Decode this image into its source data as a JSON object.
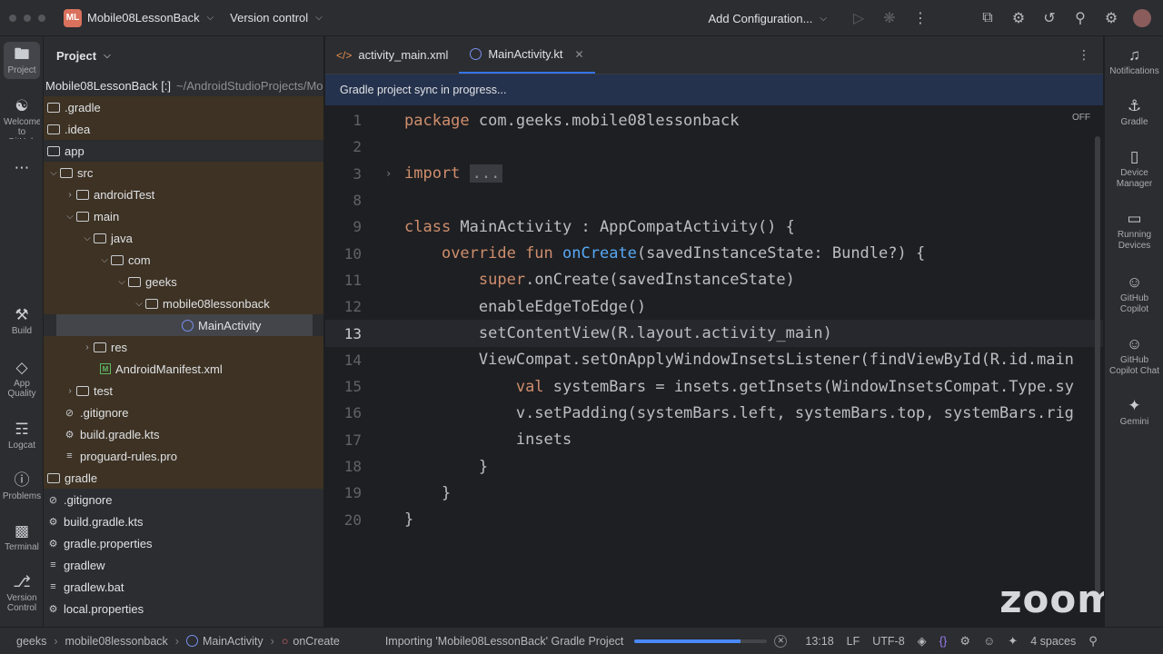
{
  "titlebar": {
    "project_badge": "ML",
    "project_name": "Mobile08LessonBack",
    "vcs_label": "Version control",
    "add_config": "Add Configuration..."
  },
  "left_strip": [
    {
      "label": "Project",
      "icon": "folder-icon"
    },
    {
      "label": "Welcome to GitHub",
      "icon": "github-icon"
    },
    {
      "label": "Build",
      "icon": "hammer-icon"
    },
    {
      "label": "App Quality",
      "icon": "diamond-icon"
    },
    {
      "label": "Logcat",
      "icon": "logcat-icon"
    },
    {
      "label": "Problems",
      "icon": "warning-icon"
    },
    {
      "label": "Terminal",
      "icon": "terminal-icon"
    },
    {
      "label": "Version Control",
      "icon": "git-branch-icon"
    }
  ],
  "project_panel": {
    "title": "Project",
    "root_name": "Mobile08LessonBack [:]",
    "root_path": "~/AndroidStudioProjects/Mobile08LessonBack",
    "tree": [
      {
        "label": ".gradle"
      },
      {
        "label": ".idea"
      },
      {
        "label": "app"
      },
      {
        "label": "src"
      },
      {
        "label": "androidTest"
      },
      {
        "label": "main"
      },
      {
        "label": "java"
      },
      {
        "label": "com"
      },
      {
        "label": "geeks"
      },
      {
        "label": "mobile08lessonback"
      },
      {
        "label": "MainActivity"
      },
      {
        "label": "res"
      },
      {
        "label": "AndroidManifest.xml"
      },
      {
        "label": "test"
      },
      {
        "label": ".gitignore"
      },
      {
        "label": "build.gradle.kts"
      },
      {
        "label": "proguard-rules.pro"
      },
      {
        "label": "gradle"
      },
      {
        "label": ".gitignore"
      },
      {
        "label": "build.gradle.kts"
      },
      {
        "label": "gradle.properties"
      },
      {
        "label": "gradlew"
      },
      {
        "label": "gradlew.bat"
      },
      {
        "label": "local.properties"
      }
    ]
  },
  "editor": {
    "tabs": [
      {
        "label": "activity_main.xml"
      },
      {
        "label": "MainActivity.kt"
      }
    ],
    "banner": "Gradle project sync in progress...",
    "inspection_label": "OFF",
    "line_numbers": [
      "1",
      "2",
      "3",
      "8",
      "9",
      "10",
      "11",
      "12",
      "13",
      "14",
      "15",
      "16",
      "17",
      "18",
      "19",
      "20"
    ],
    "code": {
      "l1_kw": "package",
      "l1_rest": " com.geeks.mobile08lessonback",
      "l3_kw": "import",
      "l3_dots": "...",
      "l9_kw": "class",
      "l9_rest": " MainActivity : AppCompatActivity() {",
      "l10_kw": "override fun",
      "l10_fn": "onCreate",
      "l10_rest": "(savedInstanceState: Bundle?) {",
      "l11_kw": "super",
      "l11_rest": ".onCreate(savedInstanceState)",
      "l12": "enableEdgeToEdge()",
      "l13": "setContentView(R.layout.activity_main)",
      "l14": "ViewCompat.setOnApplyWindowInsetsListener(findViewById(R.id.main",
      "l15_kw": "val",
      "l15_rest": " systemBars = insets.getInsets(WindowInsetsCompat.Type.sy",
      "l16": "v.setPadding(systemBars.left, systemBars.top, systemBars.rig",
      "l17": "insets",
      "l18": "}",
      "l19": "}",
      "l20": "}"
    },
    "watermark": "zoom"
  },
  "right_strip": [
    {
      "label": "Notifications",
      "icon": "bell-icon"
    },
    {
      "label": "Gradle",
      "icon": "gradle-icon"
    },
    {
      "label": "Device Manager",
      "icon": "device-icon"
    },
    {
      "label": "Running Devices",
      "icon": "running-device-icon"
    },
    {
      "label": "GitHub Copilot",
      "icon": "copilot-icon"
    },
    {
      "label": "GitHub Copilot Chat",
      "icon": "copilot-chat-icon"
    },
    {
      "label": "Gemini",
      "icon": "gemini-icon"
    }
  ],
  "statusbar": {
    "crumbs": [
      "geeks",
      "mobile08lessonback",
      "MainActivity",
      "onCreate"
    ],
    "progress_text": "Importing 'Mobile08LessonBack' Gradle Project",
    "progress_fraction": 0.8,
    "position": "13:18",
    "line_sep": "LF",
    "encoding": "UTF-8",
    "indent": "4 spaces"
  }
}
